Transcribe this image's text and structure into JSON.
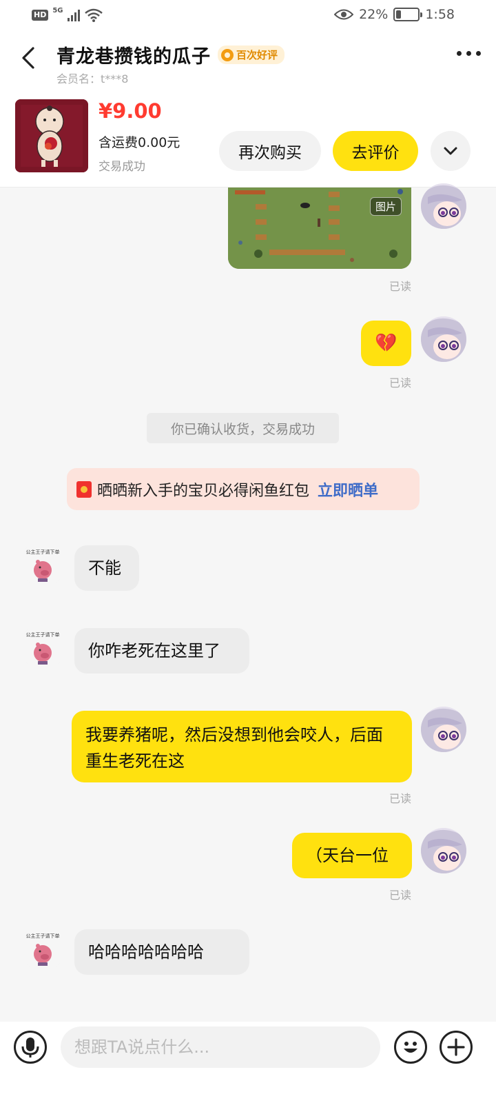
{
  "status_bar": {
    "hd": "HD",
    "network": "5G",
    "battery": "22%",
    "battery_level": 0.22,
    "time": "1:58"
  },
  "header": {
    "shop_name": "青龙巷攒钱的瓜子",
    "badge": "百次好评",
    "member_name": "会员名：t***8"
  },
  "product": {
    "price": "¥9.00",
    "shipping": "含运费0.00元",
    "status": "交易成功",
    "rebuy_label": "再次购买",
    "review_label": "去评价"
  },
  "messages": {
    "image_tag": "图片",
    "read_label": "已读",
    "emoji": "💔",
    "system_tip": "你已确认收货，交易成功",
    "promo_text": "晒晒新入手的宝贝必得闲鱼红包",
    "promo_link": "立即晒单",
    "msg_1": "不能",
    "msg_2": "你咋老死在这里了",
    "msg_3": "我要养猪呢，然后没想到他会咬人，后面重生老死在这",
    "msg_4": "（天台一位",
    "msg_5": "哈哈哈哈哈哈哈",
    "other_avatar_text": "公主王子请下单"
  },
  "input": {
    "placeholder": "想跟TA说点什么..."
  }
}
